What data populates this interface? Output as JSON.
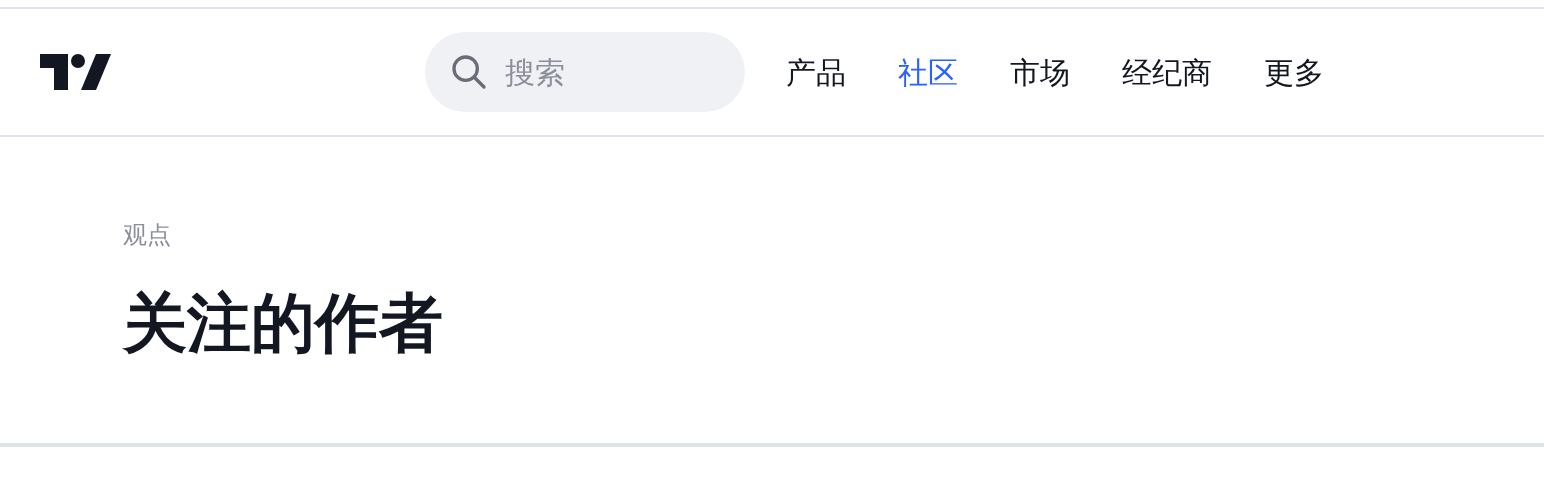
{
  "header": {
    "search": {
      "placeholder": "搜索"
    },
    "nav": [
      {
        "label": "产品",
        "selected": false
      },
      {
        "label": "社区",
        "selected": true
      },
      {
        "label": "市场",
        "selected": false
      },
      {
        "label": "经纪商",
        "selected": false
      },
      {
        "label": "更多",
        "selected": false
      }
    ]
  },
  "breadcrumb": "观点",
  "title": "关注的作者"
}
